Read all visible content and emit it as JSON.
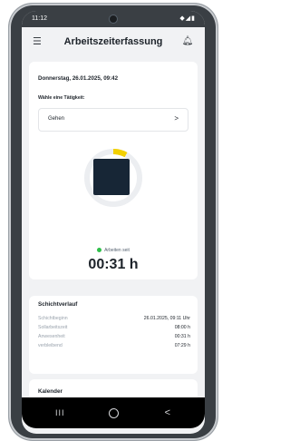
{
  "status_bar": {
    "time": "11:12",
    "icons": "◆◢▮"
  },
  "app_bar": {
    "title": "Arbeitszeiterfassung",
    "menu_icon": "menu-icon",
    "bell_icon": "bell-icon"
  },
  "main_card": {
    "date": "Donnerstag, 26.01.2025, 09:42",
    "prompt": "Wähle eine Tätigkeit:",
    "activity": {
      "value": "Gehen",
      "chevron": ">"
    },
    "timer": {
      "progress": 0.08,
      "accent": "#f2d000",
      "ring_color": "#eceef1",
      "stop_color": "#172636"
    },
    "status": {
      "label": "Arbeiten seit",
      "color": "#2fbf4a"
    },
    "elapsed": "00:31 h"
  },
  "shift": {
    "title": "Schichtverlauf",
    "rows": [
      {
        "key": "Schichtbeginn",
        "value": "26.01.2025, 09:11 Uhr"
      },
      {
        "key": "Sollarbeitszeit",
        "value": "08:00 h"
      },
      {
        "key": "Anwesenheit",
        "value": "00:31 h"
      },
      {
        "key": "verbleibend",
        "value": "07:29 h"
      }
    ]
  },
  "calendar": {
    "title": "Kalender"
  },
  "nav_bar": {
    "recents": "III",
    "back": "<"
  }
}
